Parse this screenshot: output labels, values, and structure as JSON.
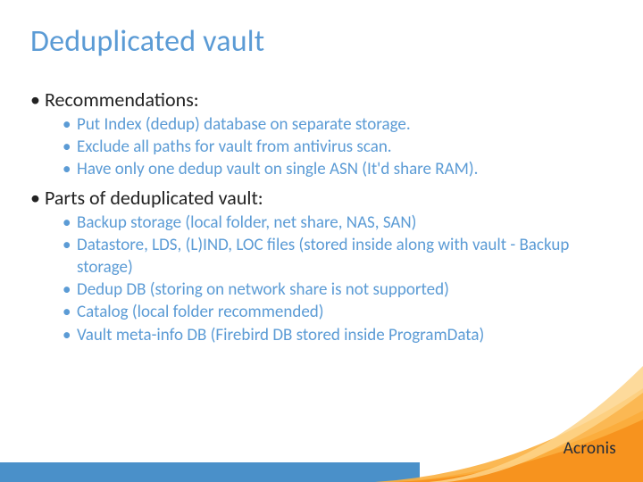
{
  "title": "Deduplicated vault",
  "sections": [
    {
      "heading": "Recommendations:",
      "items": [
        "Put Index (dedup) database on separate storage.",
        "Exclude all paths for vault from antivirus scan.",
        "Have only one dedup vault on single ASN (It'd share RAM)."
      ]
    },
    {
      "heading": "Parts of deduplicated vault:",
      "items": [
        "Backup storage (local folder, net share, NAS, SAN)",
        "Datastore, LDS, (L)IND, LOC files (stored inside along with vault - Backup storage)",
        "Dedup DB (storing on network share is not supported)",
        "Catalog (local folder recommended)",
        "Vault meta-info DB (Firebird DB stored inside ProgramData)"
      ]
    }
  ],
  "logo": "Acronis"
}
